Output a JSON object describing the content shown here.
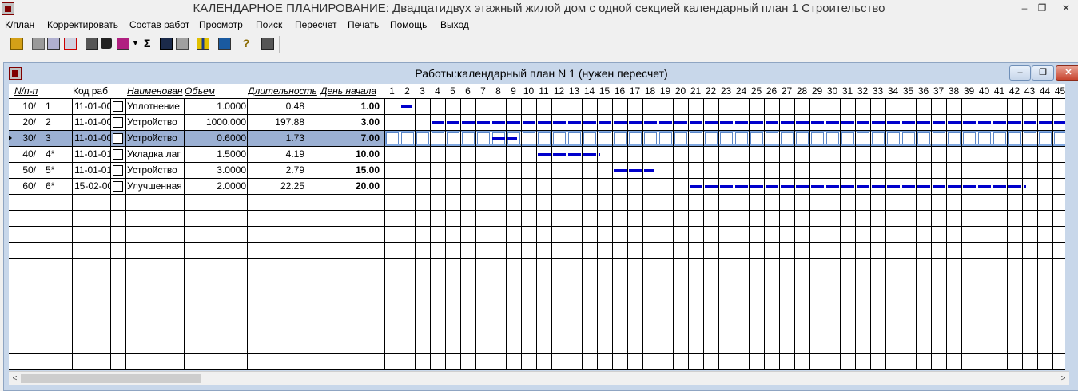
{
  "window": {
    "title": "КАЛЕНДАРНОЕ ПЛАНИРОВАНИЕ: Двадцатидвух этажный жилой дом с одной секцией календарный план 1 Строительство",
    "minimize": "–",
    "restore": "❐",
    "close": "✕"
  },
  "menu": [
    "К/план",
    "Корректировать",
    "Состав работ",
    "Просмотр",
    "Поиск",
    "Пересчет",
    "Печать",
    "Помощь",
    "Выход"
  ],
  "toolbar_icons": [
    "open-icon",
    "new-icon",
    "edit-icon",
    "delete-icon",
    "print-icon",
    "link-icon",
    "filter-icon",
    "dropdown-icon",
    "sum-icon",
    "save-icon",
    "undo-icon",
    "columns-icon",
    "chart-icon",
    "help-icon",
    "exit-icon"
  ],
  "sum_symbol": "Σ",
  "help_symbol": "?",
  "inner": {
    "title": "Работы:календарный план  N 1 (нужен пересчет)",
    "min": "–",
    "restore": "❐",
    "close": "✕"
  },
  "columns": {
    "num": "N/п-п",
    "code": "Код раб",
    "name": "Наименован",
    "volume": "Объем",
    "duration": "Длительность",
    "start": "День начала"
  },
  "days": [
    "1",
    "2",
    "3",
    "4",
    "5",
    "6",
    "7",
    "8",
    "9",
    "10",
    "11",
    "12",
    "13",
    "14",
    "15",
    "16",
    "17",
    "18",
    "19",
    "20",
    "21",
    "22",
    "23",
    "24",
    "25",
    "26",
    "27",
    "28",
    "29",
    "30",
    "31",
    "32",
    "33",
    "34",
    "35",
    "36",
    "37",
    "38",
    "39",
    "40",
    "41",
    "42",
    "43",
    "44",
    "45"
  ],
  "rows": [
    {
      "n1": "10/",
      "n2": "1",
      "code": "11-01-00",
      "name": "Уплотнение",
      "volume": "1.0000",
      "duration": "0.48",
      "start": "1.00",
      "gantt_start": 1.0,
      "gantt_duration": 0.48
    },
    {
      "n1": "20/",
      "n2": "2",
      "code": "11-01-00",
      "name": "Устройство",
      "volume": "1000.000",
      "duration": "197.88",
      "start": "3.00",
      "gantt_start": 3.0,
      "gantt_duration": 197.88
    },
    {
      "n1": "30/",
      "n2": "3",
      "code": "11-01-00",
      "name": "Устройство",
      "volume": "0.6000",
      "duration": "1.73",
      "start": "7.00",
      "gantt_start": 7.0,
      "gantt_duration": 1.73
    },
    {
      "n1": "40/",
      "n2": "4*",
      "code": "11-01-01",
      "name": "Укладка лаг",
      "volume": "1.5000",
      "duration": "4.19",
      "start": "10.00",
      "gantt_start": 10.0,
      "gantt_duration": 4.19
    },
    {
      "n1": "50/",
      "n2": "5*",
      "code": "11-01-01",
      "name": "Устройство",
      "volume": "3.0000",
      "duration": "2.79",
      "start": "15.00",
      "gantt_start": 15.0,
      "gantt_duration": 2.79
    },
    {
      "n1": "60/",
      "n2": "6*",
      "code": "15-02-00",
      "name": "Улучшенная",
      "volume": "2.0000",
      "duration": "22.25",
      "start": "20.00",
      "gantt_start": 20.0,
      "gantt_duration": 22.25
    }
  ],
  "selected_row": 2,
  "colors": {
    "bar": "#0000cc",
    "selection": "#9bb0d3",
    "inner_frame": "#c8d7ea"
  }
}
